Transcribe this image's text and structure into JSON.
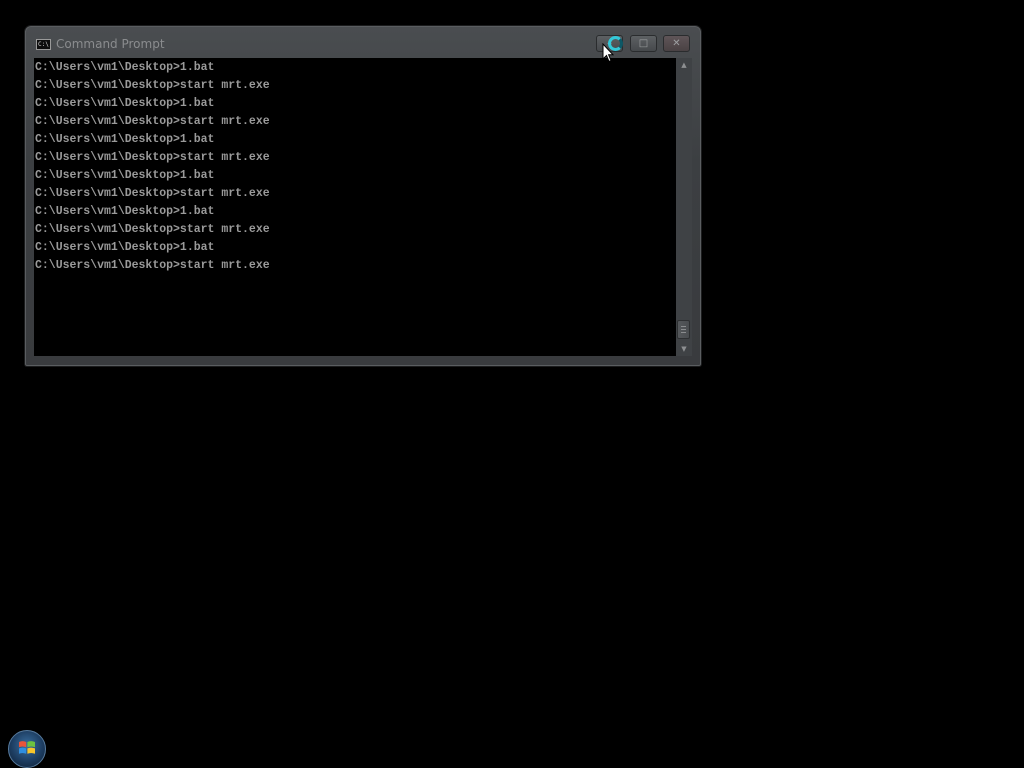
{
  "window": {
    "title": "Command Prompt",
    "app_icon_text": "C:\\",
    "controls": {
      "minimize": "–",
      "maximize": "□",
      "close": "✕"
    }
  },
  "console": {
    "lines": [
      "C:\\Users\\vm1\\Desktop>1.bat",
      "C:\\Users\\vm1\\Desktop>start mrt.exe",
      "C:\\Users\\vm1\\Desktop>1.bat",
      "C:\\Users\\vm1\\Desktop>start mrt.exe",
      "C:\\Users\\vm1\\Desktop>1.bat",
      "C:\\Users\\vm1\\Desktop>start mrt.exe",
      "C:\\Users\\vm1\\Desktop>1.bat",
      "C:\\Users\\vm1\\Desktop>start mrt.exe",
      "C:\\Users\\vm1\\Desktop>1.bat",
      "C:\\Users\\vm1\\Desktop>start mrt.exe",
      "C:\\Users\\vm1\\Desktop>1.bat",
      "C:\\Users\\vm1\\Desktop>start mrt.exe"
    ]
  },
  "scrollbar": {
    "up_arrow": "▲",
    "down_arrow": "▼"
  },
  "icons": {
    "app": "console-icon",
    "cursor": "busy-cursor-icon",
    "start": "windows-start-icon"
  },
  "colors": {
    "console_text": "#9a9a9a",
    "busy_ring": "#33c8d8"
  }
}
